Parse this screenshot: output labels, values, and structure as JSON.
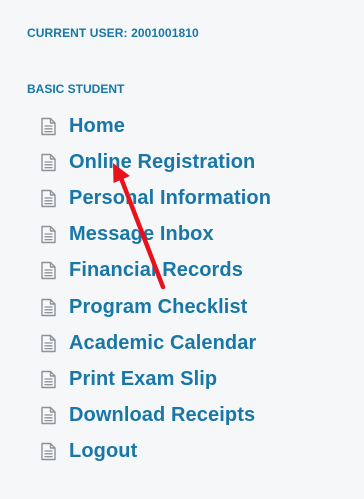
{
  "colors": {
    "accent": "#1877a6",
    "icon": "#8e9296",
    "background": "#f5f7f9",
    "annotation": "#e8121d"
  },
  "header": {
    "current_user": "CURRENT USER: 2001001810"
  },
  "section": {
    "label": "BASIC STUDENT"
  },
  "menu": {
    "items": [
      {
        "label": "Home",
        "icon": "document-icon"
      },
      {
        "label": "Online Registration",
        "icon": "document-icon"
      },
      {
        "label": "Personal Information",
        "icon": "document-icon"
      },
      {
        "label": "Message Inbox",
        "icon": "document-icon"
      },
      {
        "label": "Financial Records",
        "icon": "document-icon"
      },
      {
        "label": "Program Checklist",
        "icon": "document-icon"
      },
      {
        "label": "Academic Calendar",
        "icon": "document-icon"
      },
      {
        "label": "Print Exam Slip",
        "icon": "document-icon"
      },
      {
        "label": "Download Receipts",
        "icon": "document-icon"
      },
      {
        "label": "Logout",
        "icon": "document-icon"
      }
    ]
  },
  "annotation": {
    "type": "arrow",
    "points_to": "Online Registration"
  }
}
